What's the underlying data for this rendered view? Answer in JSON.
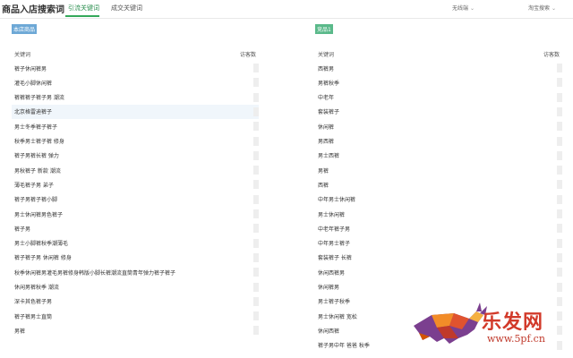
{
  "header": {
    "title": "商品入店搜索词",
    "tabs": [
      {
        "label": "引流关键词",
        "active": true
      },
      {
        "label": "成交关键词",
        "active": false
      }
    ],
    "dropdowns": [
      {
        "label": "无线端",
        "icon": "chevron-down-icon"
      },
      {
        "label": "淘宝搜索",
        "icon": "chevron-down-icon"
      }
    ]
  },
  "left": {
    "tag": "本店商品",
    "col_keyword": "关键词",
    "col_visitors": "访客数",
    "rows": [
      "裤子休闲裤男",
      "灌毛小脚休闲裤",
      "裤裤裤子裤子男 潮流",
      "北京格雷迪裤子",
      "男士冬季裤子裤子",
      "秋季男士裤子裤 修身",
      "裤子男裤长裤 弹力",
      "男秋裤子 新款 潮流",
      "薄毛裤子男 弟子",
      "裤子男裤子裤小脚",
      "男士休闲裤男色裤子",
      "裤子男",
      "男士小脚裤秋季潮薄毛",
      "裤子裤子男 休闲裤 修身",
      "秋季休闲裤男灌毛男裤修身韩版小脚长裤潮流直筒青年弹力裤子裤子",
      "休闲男裤秋季 潮流",
      "深卡其色裤子男",
      "裤子裤男士直筒",
      "男裤"
    ],
    "highlight_index": 3
  },
  "right": {
    "tag": "竞品1",
    "col_keyword": "关键词",
    "col_visitors": "访客数",
    "rows": [
      "西裤男",
      "男裤秋季",
      "中老年",
      "套装裤子",
      "休闲裤",
      "男西裤",
      "男士西裤",
      "男裤",
      "西裤",
      "中年男士休闲裤",
      "男士休闲裤",
      "中老年裤子男",
      "中年男士裤子",
      "套装裤子 长裤",
      "休闲西裤男",
      "休闲裤男",
      "男士裤子秋季",
      "男士休闲裤 宽松",
      "休闲西裤",
      "裤子男中年 爸爸 秋季"
    ]
  },
  "watermark": {
    "text": "乐发网",
    "url": "www.5pf.cn",
    "colors": {
      "primary": "#d23a2a",
      "bull_purple": "#7b3f8f",
      "bull_orange": "#f28c28"
    }
  },
  "colors": {
    "accent": "#34a85a",
    "tag_blue": "#6da8d6",
    "tag_green": "#5ab98a"
  }
}
